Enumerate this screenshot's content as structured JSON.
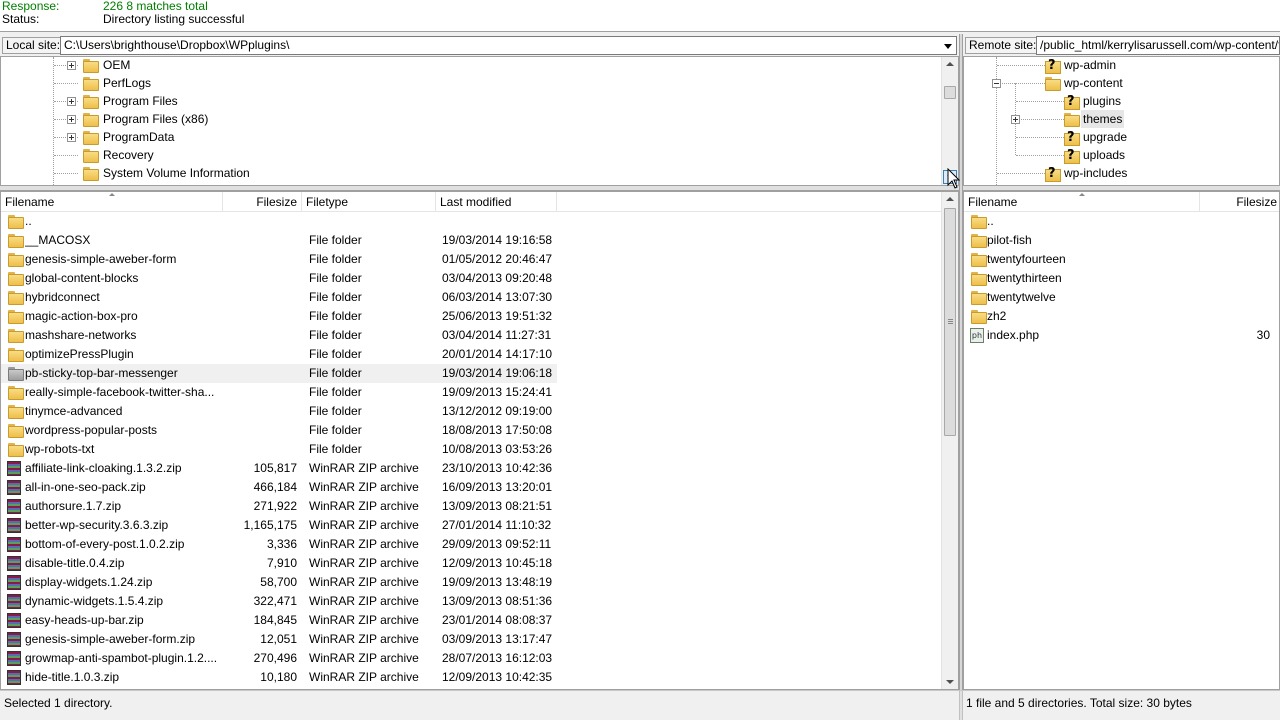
{
  "log": {
    "response_label": "Response:",
    "response_text": "226 8 matches total",
    "status_label": "Status:",
    "status_text": "Directory listing successful"
  },
  "local": {
    "site_label": "Local site:",
    "path": "C:\\Users\\brighthouse\\Dropbox\\WPplugins\\",
    "tree": [
      {
        "name": "OEM",
        "expander": "plus"
      },
      {
        "name": "PerfLogs",
        "expander": "none"
      },
      {
        "name": "Program Files",
        "expander": "plus"
      },
      {
        "name": "Program Files (x86)",
        "expander": "plus"
      },
      {
        "name": "ProgramData",
        "expander": "plus"
      },
      {
        "name": "Recovery",
        "expander": "none"
      },
      {
        "name": "System Volume Information",
        "expander": "none"
      }
    ],
    "columns": {
      "filename": "Filename",
      "filesize": "Filesize",
      "filetype": "Filetype",
      "modified": "Last modified"
    },
    "files": [
      {
        "name": "..",
        "size": "",
        "type": "",
        "modified": "",
        "icon": "folder"
      },
      {
        "name": "__MACOSX",
        "size": "",
        "type": "File folder",
        "modified": "19/03/2014 19:16:58",
        "icon": "folder"
      },
      {
        "name": "genesis-simple-aweber-form",
        "size": "",
        "type": "File folder",
        "modified": "01/05/2012 20:46:47",
        "icon": "folder"
      },
      {
        "name": "global-content-blocks",
        "size": "",
        "type": "File folder",
        "modified": "03/04/2013 09:20:48",
        "icon": "folder"
      },
      {
        "name": "hybridconnect",
        "size": "",
        "type": "File folder",
        "modified": "06/03/2014 13:07:30",
        "icon": "folder"
      },
      {
        "name": "magic-action-box-pro",
        "size": "",
        "type": "File folder",
        "modified": "25/06/2013 19:51:32",
        "icon": "folder"
      },
      {
        "name": "mashshare-networks",
        "size": "",
        "type": "File folder",
        "modified": "03/04/2014 11:27:31",
        "icon": "folder"
      },
      {
        "name": "optimizePressPlugin",
        "size": "",
        "type": "File folder",
        "modified": "20/01/2014 14:17:10",
        "icon": "folder"
      },
      {
        "name": "pb-sticky-top-bar-messenger",
        "size": "",
        "type": "File folder",
        "modified": "19/03/2014 19:06:18",
        "icon": "folder-grey",
        "highlight": true
      },
      {
        "name": "really-simple-facebook-twitter-sha...",
        "size": "",
        "type": "File folder",
        "modified": "19/09/2013 15:24:41",
        "icon": "folder"
      },
      {
        "name": "tinymce-advanced",
        "size": "",
        "type": "File folder",
        "modified": "13/12/2012 09:19:00",
        "icon": "folder"
      },
      {
        "name": "wordpress-popular-posts",
        "size": "",
        "type": "File folder",
        "modified": "18/08/2013 17:50:08",
        "icon": "folder"
      },
      {
        "name": "wp-robots-txt",
        "size": "",
        "type": "File folder",
        "modified": "10/08/2013 03:53:26",
        "icon": "folder"
      },
      {
        "name": "affiliate-link-cloaking.1.3.2.zip",
        "size": "105,817",
        "type": "WinRAR ZIP archive",
        "modified": "23/10/2013 10:42:36",
        "icon": "zip"
      },
      {
        "name": "all-in-one-seo-pack.zip",
        "size": "466,184",
        "type": "WinRAR ZIP archive",
        "modified": "16/09/2013 13:20:01",
        "icon": "zip"
      },
      {
        "name": "authorsure.1.7.zip",
        "size": "271,922",
        "type": "WinRAR ZIP archive",
        "modified": "13/09/2013 08:21:51",
        "icon": "zip"
      },
      {
        "name": "better-wp-security.3.6.3.zip",
        "size": "1,165,175",
        "type": "WinRAR ZIP archive",
        "modified": "27/01/2014 11:10:32",
        "icon": "zip"
      },
      {
        "name": "bottom-of-every-post.1.0.2.zip",
        "size": "3,336",
        "type": "WinRAR ZIP archive",
        "modified": "29/09/2013 09:52:11",
        "icon": "zip"
      },
      {
        "name": "disable-title.0.4.zip",
        "size": "7,910",
        "type": "WinRAR ZIP archive",
        "modified": "12/09/2013 10:45:18",
        "icon": "zip"
      },
      {
        "name": "display-widgets.1.24.zip",
        "size": "58,700",
        "type": "WinRAR ZIP archive",
        "modified": "19/09/2013 13:48:19",
        "icon": "zip"
      },
      {
        "name": "dynamic-widgets.1.5.4.zip",
        "size": "322,471",
        "type": "WinRAR ZIP archive",
        "modified": "13/09/2013 08:51:36",
        "icon": "zip"
      },
      {
        "name": "easy-heads-up-bar.zip",
        "size": "184,845",
        "type": "WinRAR ZIP archive",
        "modified": "23/01/2014 08:08:37",
        "icon": "zip"
      },
      {
        "name": "genesis-simple-aweber-form.zip",
        "size": "12,051",
        "type": "WinRAR ZIP archive",
        "modified": "03/09/2013 13:17:47",
        "icon": "zip"
      },
      {
        "name": "growmap-anti-spambot-plugin.1.2....",
        "size": "270,496",
        "type": "WinRAR ZIP archive",
        "modified": "28/07/2013 16:12:03",
        "icon": "zip"
      },
      {
        "name": "hide-title.1.0.3.zip",
        "size": "10,180",
        "type": "WinRAR ZIP archive",
        "modified": "12/09/2013 10:42:35",
        "icon": "zip"
      }
    ],
    "status": "Selected 1 directory."
  },
  "remote": {
    "site_label": "Remote site:",
    "path": "/public_html/kerrylisarussell.com/wp-content/themes",
    "tree": [
      {
        "name": "wp-admin",
        "level": 0,
        "expander": "none",
        "icon": "q"
      },
      {
        "name": "wp-content",
        "level": 0,
        "expander": "minus",
        "icon": "folder"
      },
      {
        "name": "plugins",
        "level": 1,
        "expander": "none",
        "icon": "q"
      },
      {
        "name": "themes",
        "level": 1,
        "expander": "plus",
        "icon": "folder",
        "selected": true
      },
      {
        "name": "upgrade",
        "level": 1,
        "expander": "none",
        "icon": "q"
      },
      {
        "name": "uploads",
        "level": 1,
        "expander": "none",
        "icon": "q"
      },
      {
        "name": "wp-includes",
        "level": 0,
        "expander": "none",
        "icon": "q"
      }
    ],
    "columns": {
      "filename": "Filename",
      "filesize": "Filesize"
    },
    "files": [
      {
        "name": "..",
        "size": "",
        "icon": "folder"
      },
      {
        "name": "pilot-fish",
        "size": "",
        "icon": "folder"
      },
      {
        "name": "twentyfourteen",
        "size": "",
        "icon": "folder"
      },
      {
        "name": "twentythirteen",
        "size": "",
        "icon": "folder"
      },
      {
        "name": "twentytwelve",
        "size": "",
        "icon": "folder"
      },
      {
        "name": "zh2",
        "size": "",
        "icon": "folder"
      },
      {
        "name": "index.php",
        "size": "30",
        "icon": "php"
      }
    ],
    "status": "1 file and 5 directories. Total size: 30 bytes"
  },
  "icons": {
    "php_glyph": "ph"
  },
  "scroll": {
    "local_tree_thumb_fraction": 0.1,
    "local_list_thumb_fraction": 0.48
  }
}
